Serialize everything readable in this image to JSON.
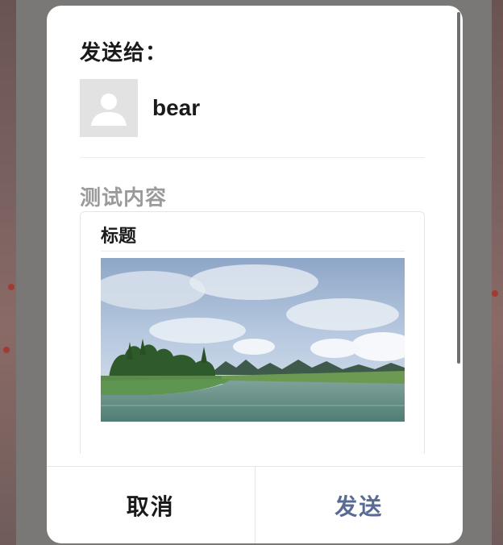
{
  "dialog": {
    "send_to_label": "发送给：",
    "recipient": {
      "name": "bear",
      "avatar_icon": "default-avatar-icon"
    },
    "content_label": "测试内容",
    "card": {
      "title": "标题",
      "image_icon": "landscape-photo"
    },
    "buttons": {
      "cancel_label": "取消",
      "send_label": "发送"
    }
  },
  "colors": {
    "send_accent": "#576b95",
    "muted_label": "#9a9a9a",
    "overlay": "#5d5a58"
  }
}
